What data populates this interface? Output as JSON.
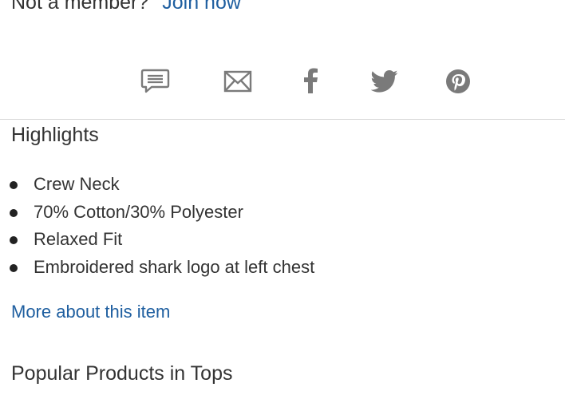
{
  "member": {
    "prompt": "Not a member?",
    "join_label": "Join now"
  },
  "share": {
    "icons": [
      "speech-bubble-icon",
      "envelope-icon",
      "facebook-icon",
      "twitter-icon",
      "pinterest-icon"
    ],
    "icon_color": "#7a7a7a"
  },
  "highlights": {
    "title": "Highlights",
    "items": [
      "Crew Neck",
      "70% Cotton/30% Polyester",
      "Relaxed Fit",
      "Embroidered shark logo at left chest"
    ],
    "more_label": "More about this item"
  },
  "popular": {
    "title": "Popular Products in Tops"
  },
  "colors": {
    "link": "#1f5fa0",
    "text": "#333333",
    "divider": "#d6d6d6"
  }
}
